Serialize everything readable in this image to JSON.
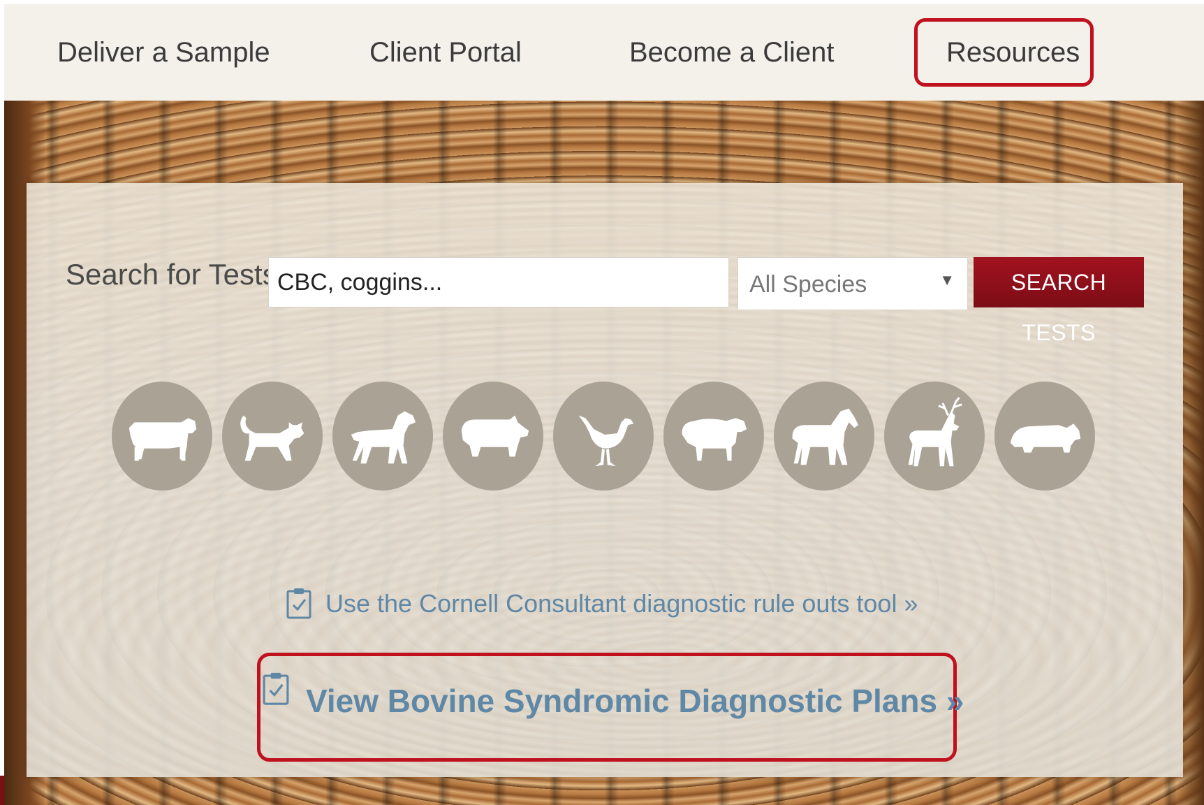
{
  "nav": {
    "items": [
      {
        "label": "Deliver a Sample"
      },
      {
        "label": "Client Portal"
      },
      {
        "label": "Become a Client"
      },
      {
        "label": "Resources"
      }
    ]
  },
  "search": {
    "label": "Search for Tests",
    "placeholder": "CBC, coggins...",
    "species_selected": "All Species",
    "button_label": "SEARCH TESTS"
  },
  "species": [
    {
      "icon": "cow-icon"
    },
    {
      "icon": "cat-icon"
    },
    {
      "icon": "dog-icon"
    },
    {
      "icon": "pig-icon"
    },
    {
      "icon": "chicken-icon"
    },
    {
      "icon": "sheep-icon"
    },
    {
      "icon": "horse-icon"
    },
    {
      "icon": "deer-icon"
    },
    {
      "icon": "rhino-icon"
    }
  ],
  "links": {
    "consultant": "Use the Cornell Consultant diagnostic rule outs tool »",
    "bovine_plans": "View Bovine Syndromic Diagnostic Plans »"
  },
  "colors": {
    "accent_red": "#9b111e",
    "highlight_red": "#c0111f",
    "link_blue": "#5f87a6",
    "circle_fill": "#aaa294"
  }
}
